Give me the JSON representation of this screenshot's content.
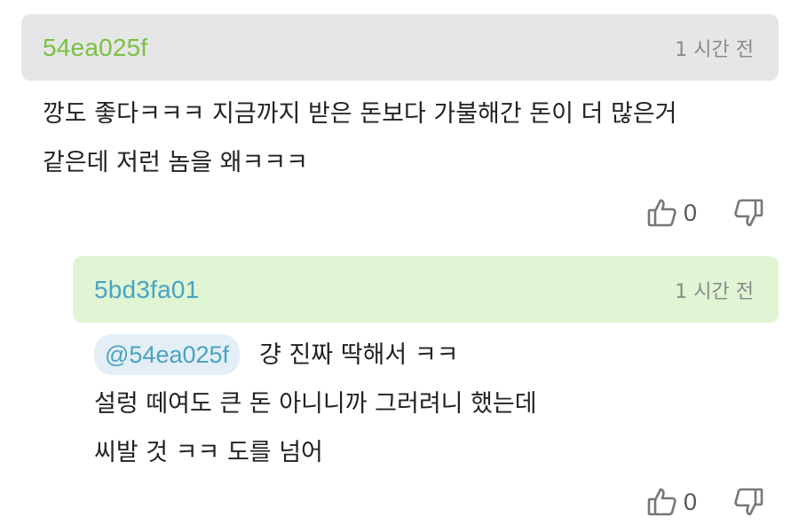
{
  "comments": [
    {
      "author": "54ea025f",
      "time": "1 시간 전",
      "lines": [
        "깡도 좋다ㅋㅋㅋ 지금까지 받은 돈보다 가불해간 돈이 더 많은거",
        "같은데 저런 놈을 왜ㅋㅋㅋ"
      ],
      "like_icon": "thumbs-up-icon",
      "like_count": "0",
      "dislike_icon": "thumbs-down-icon"
    },
    {
      "author": "5bd3fa01",
      "time": "1 시간 전",
      "mention": "@54ea025f",
      "lines": [
        "걍 진짜 딱해서 ㅋㅋ",
        "설렁 떼여도 큰 돈 아니니까 그러려니 했는데",
        "씨발 것 ㅋㅋ 도를 넘어"
      ],
      "like_icon": "thumbs-up-icon",
      "like_count": "0",
      "dislike_icon": "thumbs-down-icon"
    }
  ],
  "colors": {
    "parent_header_bg": "#e6e6e6",
    "reply_header_bg": "#dff5d4",
    "parent_author": "#7ac143",
    "reply_author": "#4aa3c2",
    "mention_bg": "#e3eef7"
  }
}
